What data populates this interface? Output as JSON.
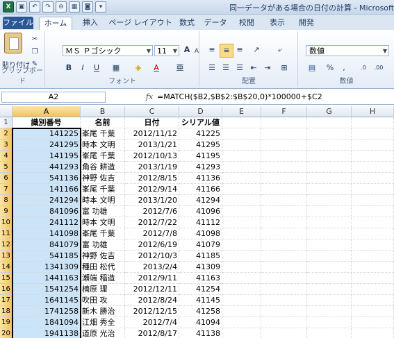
{
  "title_bar": {
    "title": "同一データがある場合の日付の計算 - Microsoft Excel",
    "qat_icons": [
      "excel-icon",
      "save-icon",
      "undo-icon",
      "redo-icon",
      "sort-icon",
      "table-icon",
      "camera-icon",
      "qat-dropdown-icon"
    ]
  },
  "tabs": [
    "ファイル",
    "ホーム",
    "挿入",
    "ページ レイアウト",
    "数式",
    "データ",
    "校閲",
    "表示",
    "開発"
  ],
  "ribbon": {
    "clipboard": {
      "paste_label": "貼り付け",
      "group_label": "クリップボード"
    },
    "font": {
      "font_name": "ＭＳ Ｐゴシック",
      "font_size": "11",
      "group_label": "フォント",
      "bold": "B",
      "italic": "I",
      "underline": "U",
      "grow": "A",
      "shrink": "A",
      "color": "A"
    },
    "alignment": {
      "group_label": "配置"
    },
    "number": {
      "format": "数値",
      "percent": "%",
      "comma": ",",
      "group_label": "数値"
    }
  },
  "formula_bar": {
    "cell_ref": "A2",
    "fx": "fx",
    "formula": "=MATCH($B2,$B$2:$B$20,0)*100000+$C2"
  },
  "sheet": {
    "columns": [
      "A",
      "B",
      "C",
      "D",
      "E",
      "F",
      "G",
      "H"
    ],
    "headers": [
      "識別番号",
      "名前",
      "日付",
      "シリアル値"
    ],
    "rows": [
      [
        "141225",
        "峯尾 千葉",
        "2012/11/12",
        "41225"
      ],
      [
        "241295",
        "時本 文明",
        "2013/1/21",
        "41295"
      ],
      [
        "141195",
        "峯尾 千葉",
        "2012/10/13",
        "41195"
      ],
      [
        "441293",
        "角谷 耕造",
        "2013/1/19",
        "41293"
      ],
      [
        "541136",
        "神野 佐吉",
        "2012/8/15",
        "41136"
      ],
      [
        "141166",
        "峯尾 千葉",
        "2012/9/14",
        "41166"
      ],
      [
        "241294",
        "時本 文明",
        "2013/1/20",
        "41294"
      ],
      [
        "841096",
        "富 功雄",
        "2012/7/6",
        "41096"
      ],
      [
        "241112",
        "時本 文明",
        "2012/7/22",
        "41112"
      ],
      [
        "141098",
        "峯尾 千葉",
        "2012/7/8",
        "41098"
      ],
      [
        "841079",
        "富 功雄",
        "2012/6/19",
        "41079"
      ],
      [
        "541185",
        "神野 佐吉",
        "2012/10/3",
        "41185"
      ],
      [
        "1341309",
        "種田 松代",
        "2013/2/4",
        "41309"
      ],
      [
        "1441163",
        "瀬端 稲造",
        "2012/9/11",
        "41163"
      ],
      [
        "1541254",
        "楠原 理",
        "2012/12/11",
        "41254"
      ],
      [
        "1641145",
        "吹田 攻",
        "2012/8/24",
        "41145"
      ],
      [
        "1741258",
        "新木 勝治",
        "2012/12/15",
        "41258"
      ],
      [
        "1841094",
        "江畑 秀全",
        "2012/7/4",
        "41094"
      ],
      [
        "1941138",
        "道原 光治",
        "2012/8/17",
        "41138"
      ]
    ],
    "row_numbers": [
      "1",
      "2",
      "3",
      "4",
      "5",
      "6",
      "7",
      "8",
      "9",
      "10",
      "11",
      "12",
      "13",
      "14",
      "15",
      "16",
      "17",
      "18",
      "19",
      "20",
      "21"
    ]
  },
  "colors": {
    "selection_fill": "#cce4f7",
    "header_highlight": "#f3c35b",
    "file_tab": "#2b5797"
  }
}
